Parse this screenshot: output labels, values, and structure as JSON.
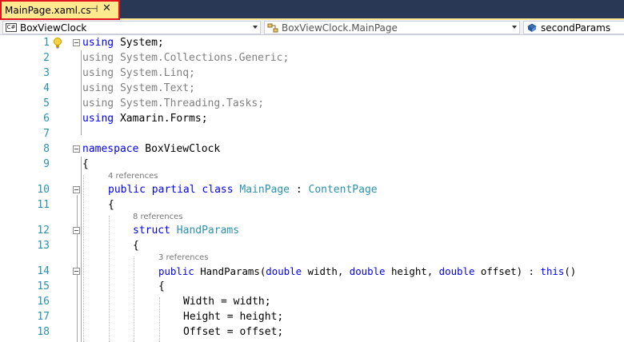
{
  "tab": {
    "title": "MainPage.xaml.cs",
    "pin_icon": "pin-icon",
    "close_icon": "close-icon",
    "highlight_color": "#e1141b"
  },
  "navbar": {
    "project": "BoxViewClock",
    "type": "BoxViewClock.MainPage",
    "member": "secondParams"
  },
  "code_lines": [
    {
      "num": "1",
      "text": "using System;"
    },
    {
      "num": "2",
      "text": "using System.Collections.Generic;"
    },
    {
      "num": "3",
      "text": "using System.Linq;"
    },
    {
      "num": "4",
      "text": "using System.Text;"
    },
    {
      "num": "5",
      "text": "using System.Threading.Tasks;"
    },
    {
      "num": "6",
      "text": "using Xamarin.Forms;"
    },
    {
      "num": "7",
      "text": ""
    },
    {
      "num": "8",
      "text": "namespace BoxViewClock"
    },
    {
      "num": "9",
      "text": "{"
    },
    {
      "num": "10",
      "text": "public partial class MainPage : ContentPage"
    },
    {
      "num": "11",
      "text": "{"
    },
    {
      "num": "12",
      "text": "struct HandParams"
    },
    {
      "num": "13",
      "text": "{"
    },
    {
      "num": "14",
      "text": "public HandParams(double width, double height, double offset) : this()"
    },
    {
      "num": "15",
      "text": "{"
    },
    {
      "num": "16",
      "text": "Width = width;"
    },
    {
      "num": "17",
      "text": "Height = height;"
    },
    {
      "num": "18",
      "text": "Offset = offset;"
    }
  ],
  "references": {
    "class_refs": "4 references",
    "struct_refs": "8 references",
    "ctor_refs": "3 references"
  },
  "colors": {
    "keyword": "#0000ff",
    "type": "#2b91af",
    "line_number": "#2b91af",
    "unused_using": "#808080"
  }
}
